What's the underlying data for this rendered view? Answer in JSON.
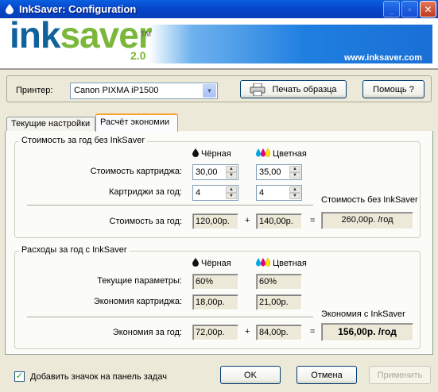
{
  "window": {
    "title": "InkSaver: Configuration"
  },
  "banner": {
    "logo_ink": "ink",
    "logo_saver": "saver",
    "logo_tm": "TM",
    "version": "2.0",
    "website": "www.inksaver.com"
  },
  "printer": {
    "label": "Принтер:",
    "selected": "Canon PIXMA iP1500",
    "print_sample_label": "Печать образца",
    "help_label": "Помощь ?"
  },
  "tabs": [
    {
      "label": "Текущие настройки"
    },
    {
      "label": "Расчёт экономии"
    }
  ],
  "cost": {
    "title": "Стоимость за год без InkSaver",
    "black_header": "Чёрная",
    "color_header": "Цветная",
    "cartridge_cost_label": "Стоимость картриджа:",
    "cartridge_cost_black": "30,00",
    "cartridge_cost_color": "35,00",
    "per_year_label": "Картриджи за год:",
    "per_year_black": "4",
    "per_year_color": "4",
    "total_caption": "Стоимость без InkSaver",
    "yearly_label": "Стоимость за год:",
    "yearly_black": "120,00р.",
    "plus": "+",
    "yearly_color": "140,00р.",
    "equals": "=",
    "yearly_total": "260,00р. /год"
  },
  "savings": {
    "title": "Расходы за год с InkSaver",
    "black_header": "Чёрная",
    "color_header": "Цветная",
    "current_label": "Текущие параметры:",
    "current_black": "60%",
    "current_color": "60%",
    "economy_label": "Экономия картриджа:",
    "economy_black": "18,00р.",
    "economy_color": "21,00р.",
    "total_caption": "Экономия с InkSaver",
    "yearly_label": "Экономия за год:",
    "yearly_black": "72,00р.",
    "plus": "+",
    "yearly_color": "84,00р.",
    "equals": "=",
    "yearly_total": "156,00р. /год"
  },
  "footer": {
    "tray_label": "Добавить значок на панель задач",
    "tray_checked": true,
    "ok_label": "OK",
    "cancel_label": "Отмена",
    "apply_label": "Применить"
  },
  "colors": {
    "title_blue": "#0844c9",
    "tab_accent": "#f7a12c",
    "logo_blue": "#10629c",
    "logo_green": "#7ab73a"
  }
}
